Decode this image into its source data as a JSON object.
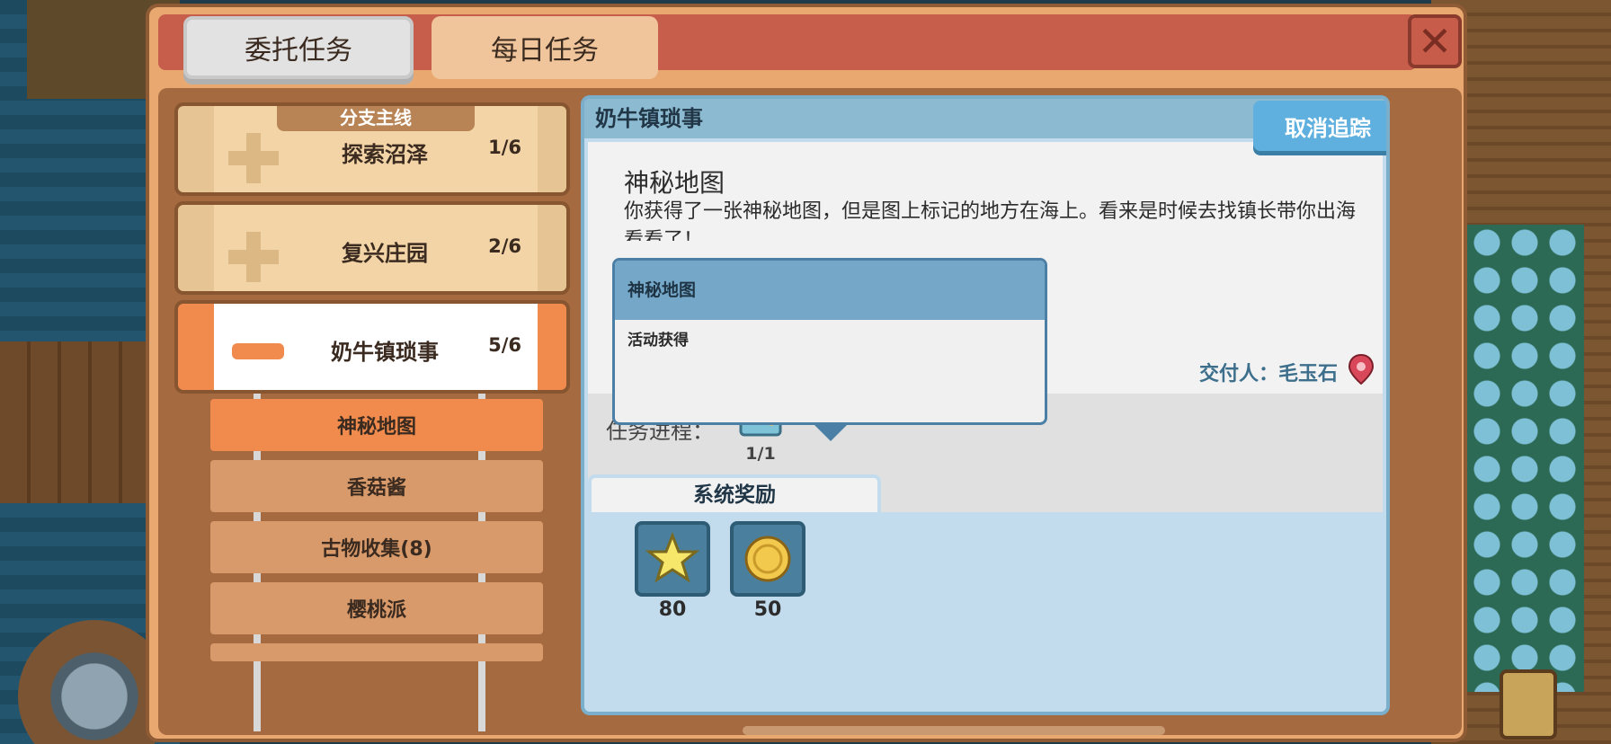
{
  "tabs": [
    {
      "label": "委托任务",
      "active": true
    },
    {
      "label": "每日任务",
      "active": false
    }
  ],
  "close_icon": "close-x-icon",
  "categories": [
    {
      "name": "探索沼泽",
      "progress": "1/6",
      "banner": "分支主线",
      "expanded": false
    },
    {
      "name": "复兴庄园",
      "progress": "2/6",
      "expanded": false
    },
    {
      "name": "奶牛镇琐事",
      "progress": "5/6",
      "expanded": true
    }
  ],
  "sub_quests": [
    {
      "name": "神秘地图",
      "active": true
    },
    {
      "name": "香菇酱",
      "active": false
    },
    {
      "name": "古物收集(8)",
      "active": false
    },
    {
      "name": "樱桃派",
      "active": false
    }
  ],
  "detail": {
    "category": "奶牛镇琐事",
    "title": "神秘地图",
    "description": "你获得了一张神秘地图，但是图上标记的地方在海上。看来是时候去找镇长带你出海看看了！",
    "cancel_label": "取消追踪",
    "giver": "交付人：毛玉石",
    "progress_label": "任务进程：",
    "progress_count": "1/1",
    "rewards_tab": "系统奖励",
    "rewards": [
      {
        "icon": "star-icon",
        "count": "80"
      },
      {
        "icon": "gold-coin-icon",
        "count": "50"
      }
    ]
  },
  "tooltip": {
    "title": "神秘地图",
    "source": "活动获得"
  },
  "colors": {
    "accent_orange": "#f08b4d",
    "panel": "#e9a870",
    "title_bar": "#c75e4b",
    "button_blue": "#5fb0de"
  }
}
